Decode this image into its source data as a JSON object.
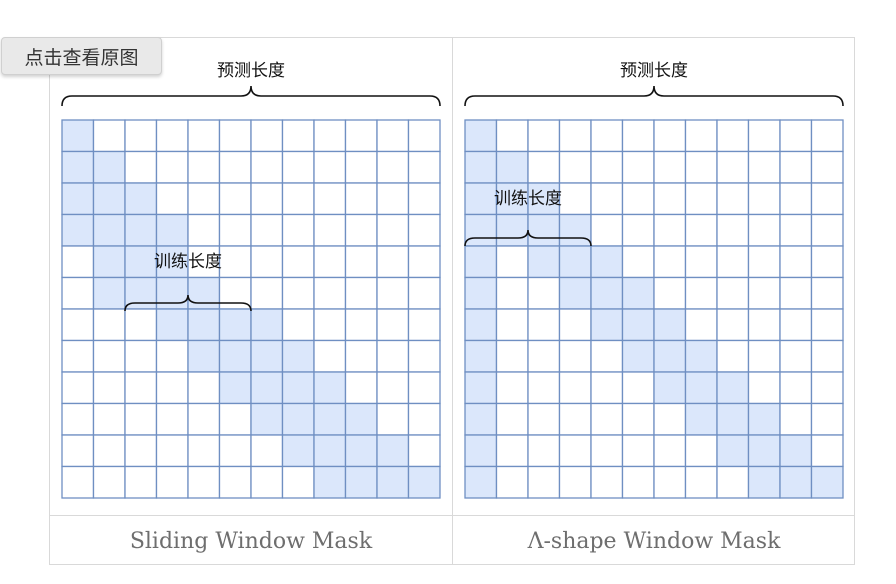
{
  "overlay": {
    "view_original_label": "点击查看原图"
  },
  "colors": {
    "grid_line": "#6f8fc2",
    "cell_fill": "#dbe7fb",
    "cell_empty": "#ffffff"
  },
  "grid": {
    "rows": 12,
    "cols": 12
  },
  "panels": [
    {
      "id": "sliding",
      "predict_label": "预测长度",
      "train_label": "训练长度",
      "caption": "Sliding Window Mask",
      "filled_rows": [
        [
          0
        ],
        [
          0,
          1
        ],
        [
          0,
          1,
          2
        ],
        [
          0,
          1,
          2,
          3
        ],
        [
          1,
          2,
          3
        ],
        [
          1,
          2,
          3,
          4
        ],
        [
          3,
          4,
          5,
          6
        ],
        [
          4,
          5,
          6,
          7
        ],
        [
          5,
          6,
          7,
          8
        ],
        [
          6,
          7,
          8,
          9
        ],
        [
          7,
          8,
          9,
          10
        ],
        [
          8,
          9,
          10,
          11
        ]
      ]
    },
    {
      "id": "lambda",
      "predict_label": "预测长度",
      "train_label": "训练长度",
      "caption": "Λ-shape Window Mask",
      "filled_rows": [
        [
          0
        ],
        [
          0,
          1
        ],
        [
          0,
          1,
          2
        ],
        [
          0,
          1,
          2,
          3
        ],
        [
          0,
          2,
          3,
          4
        ],
        [
          0,
          3,
          4,
          5
        ],
        [
          0,
          4,
          5,
          6
        ],
        [
          0,
          5,
          6,
          7
        ],
        [
          0,
          6,
          7,
          8
        ],
        [
          0,
          7,
          8,
          9
        ],
        [
          0,
          8,
          9,
          10
        ],
        [
          0,
          9,
          10,
          11
        ]
      ]
    }
  ]
}
